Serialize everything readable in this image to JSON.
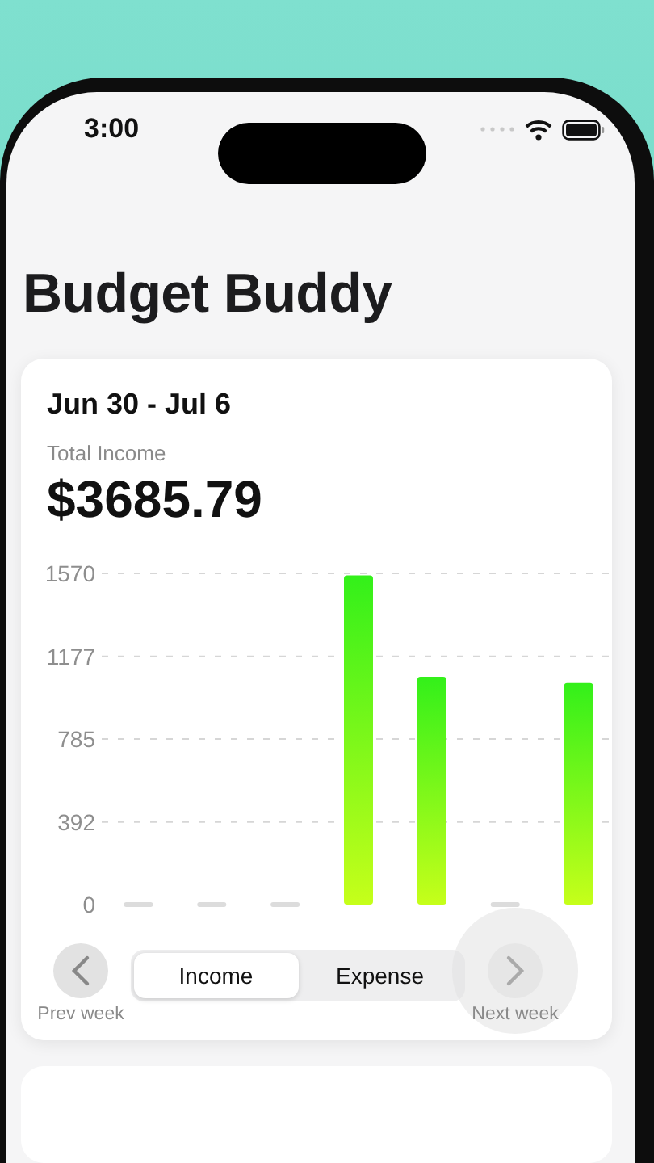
{
  "status_bar": {
    "time": "3:00"
  },
  "title": "Budget Buddy",
  "summary_card": {
    "date_range": "Jun 30 - Jul 6",
    "total_label": "Total Income",
    "total": "$3685.79",
    "chart_data": {
      "type": "bar",
      "grid": true,
      "yticks": [
        0,
        392,
        785,
        1177,
        1570
      ],
      "ylim": [
        0,
        1570
      ],
      "series": [
        {
          "color": "#33f01a",
          "values": [
            null,
            null,
            null,
            1560,
            1080,
            null,
            1050
          ]
        }
      ]
    },
    "tabs": [
      {
        "label": "Income",
        "selected": true
      },
      {
        "label": "Expense",
        "selected": false
      }
    ],
    "prev_button": {
      "label": "Prev week",
      "pressed": false
    },
    "next_button": {
      "label": "Next week",
      "pressed": true
    }
  }
}
